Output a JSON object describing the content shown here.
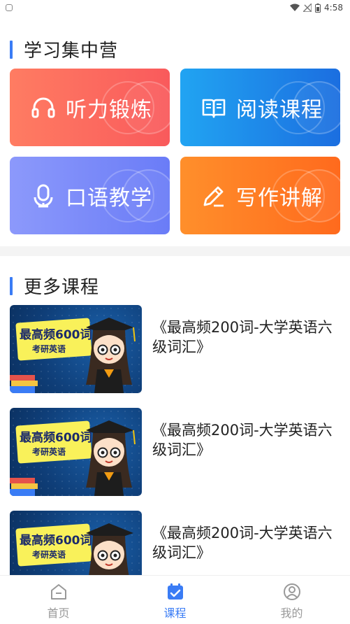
{
  "status_bar": {
    "time": "4:58"
  },
  "sections": {
    "study_camp_title": "学习集中营",
    "more_courses_title": "更多课程"
  },
  "categories": [
    {
      "label": "听力锻炼",
      "icon": "headphones-icon"
    },
    {
      "label": "阅读课程",
      "icon": "open-book-icon"
    },
    {
      "label": "口语教学",
      "icon": "microphone-icon"
    },
    {
      "label": "写作讲解",
      "icon": "pencil-icon"
    }
  ],
  "courses": [
    {
      "title": "《最高频200词-大学英语六级词汇》",
      "thumb_line1": "最高频600词",
      "thumb_line2": "考研英语"
    },
    {
      "title": "《最高频200词-大学英语六级词汇》",
      "thumb_line1": "最高频600词",
      "thumb_line2": "考研英语"
    },
    {
      "title": "《最高频200词-大学英语六级词汇》",
      "thumb_line1": "最高频600词",
      "thumb_line2": "考研英语"
    }
  ],
  "tabbar": [
    {
      "label": "首页",
      "icon": "home-icon",
      "active": false
    },
    {
      "label": "课程",
      "icon": "calendar-check-icon",
      "active": true
    },
    {
      "label": "我的",
      "icon": "user-icon",
      "active": false
    }
  ],
  "colors": {
    "accent": "#3a7cf5",
    "listening": "#f95a5c",
    "reading": "#1b6ee0",
    "speaking": "#6a7cf7",
    "writing": "#ff6a1d"
  }
}
